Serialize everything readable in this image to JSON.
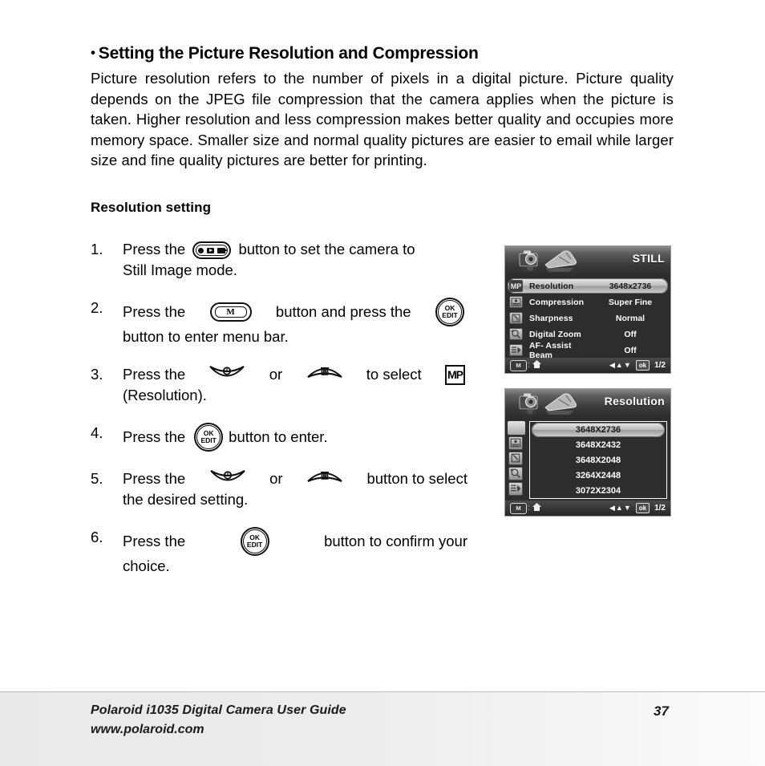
{
  "document": {
    "section_heading": "Setting the Picture Resolution and Compression",
    "bullet_glyph": "•",
    "intro_paragraph": "Picture resolution refers to the number of pixels in a digital picture. Picture quality depends on the JPEG file compression that the camera applies when the picture is taken. Higher resolution and less compression makes better quality and occupies more memory space. Smaller size and normal quality pictures are easier to email while larger size and fine quality pictures are better for printing.",
    "sub_heading": "Resolution setting"
  },
  "steps": [
    {
      "number": "1.",
      "line1_pre": "Press the",
      "icon": "mode-switch-button",
      "line1_post": "button to set the camera to",
      "line2": "Still Image mode."
    },
    {
      "number": "2.",
      "line1_pre": "Press the",
      "icon": "menu-button",
      "line1_mid": "button and press the",
      "icon2": "ok-edit-button",
      "line2": "button to enter menu bar."
    },
    {
      "number": "3.",
      "line1_pre": "Press the",
      "icon": "self-timer-arc-button",
      "line1_mid": "or",
      "icon2": "delete-arc-button",
      "line1_post": "to select",
      "icon3": "mp-badge",
      "line2": "(Resolution)."
    },
    {
      "number": "4.",
      "line1_pre": "Press the",
      "icon": "ok-edit-button",
      "line1_post": "button to enter."
    },
    {
      "number": "5.",
      "line1_pre": "Press the",
      "icon": "self-timer-arc-button",
      "line1_mid": "or",
      "icon2": "delete-arc-button",
      "line1_post": "button to select",
      "line2": "the desired setting."
    },
    {
      "number": "6.",
      "line1_pre": "Press the",
      "icon": "ok-edit-button",
      "line1_post": "button to confirm your",
      "line2": "choice."
    }
  ],
  "lcd_still": {
    "title": "STILL",
    "header_icons": [
      "camera-settings-icon",
      "wrench-tool-icon"
    ],
    "rows": [
      {
        "icon": "mp-resolution-icon",
        "label": "Resolution",
        "value": "3648x2736",
        "selected": true
      },
      {
        "icon": "compression-icon",
        "label": "Compression",
        "value": "Super Fine",
        "selected": false
      },
      {
        "icon": "sharpness-icon",
        "label": "Sharpness",
        "value": "Normal",
        "selected": false
      },
      {
        "icon": "digital-zoom-icon",
        "label": "Digital Zoom",
        "value": "Off",
        "selected": false
      },
      {
        "icon": "af-assist-icon",
        "label": "AF- Assist Beam",
        "value": "Off",
        "selected": false
      }
    ],
    "footer": {
      "menu_key": "M",
      "separator": ":",
      "home_icon": "home-icon",
      "arrows": "◀▲▼",
      "ok_key": "ok",
      "page": "1/2"
    }
  },
  "lcd_resolution": {
    "title": "Resolution",
    "header_icons": [
      "camera-settings-icon",
      "wrench-tool-icon"
    ],
    "sidebar_icons": [
      "selected-tab",
      "compression-icon",
      "sharpness-icon",
      "digital-zoom-icon",
      "af-assist-icon"
    ],
    "options": [
      {
        "label": "3648X2736",
        "selected": true
      },
      {
        "label": "3648X2432",
        "selected": false
      },
      {
        "label": "3648X2048",
        "selected": false
      },
      {
        "label": "3264X2448",
        "selected": false
      },
      {
        "label": "3072X2304",
        "selected": false
      }
    ],
    "footer": {
      "menu_key": "M",
      "separator": ":",
      "home_icon": "home-icon",
      "arrows": "◀▲▼",
      "ok_key": "ok",
      "page": "1/2"
    }
  },
  "footer": {
    "line1": "Polaroid i1035 Digital Camera User Guide",
    "line2": "www.polaroid.com",
    "page_number": "37"
  },
  "colors": {
    "page_background": "#ffffff",
    "text": "#000000",
    "lcd_background": "#2d2d2d",
    "lcd_selected": "#cfcfcf",
    "footer_band": "#ececec"
  }
}
